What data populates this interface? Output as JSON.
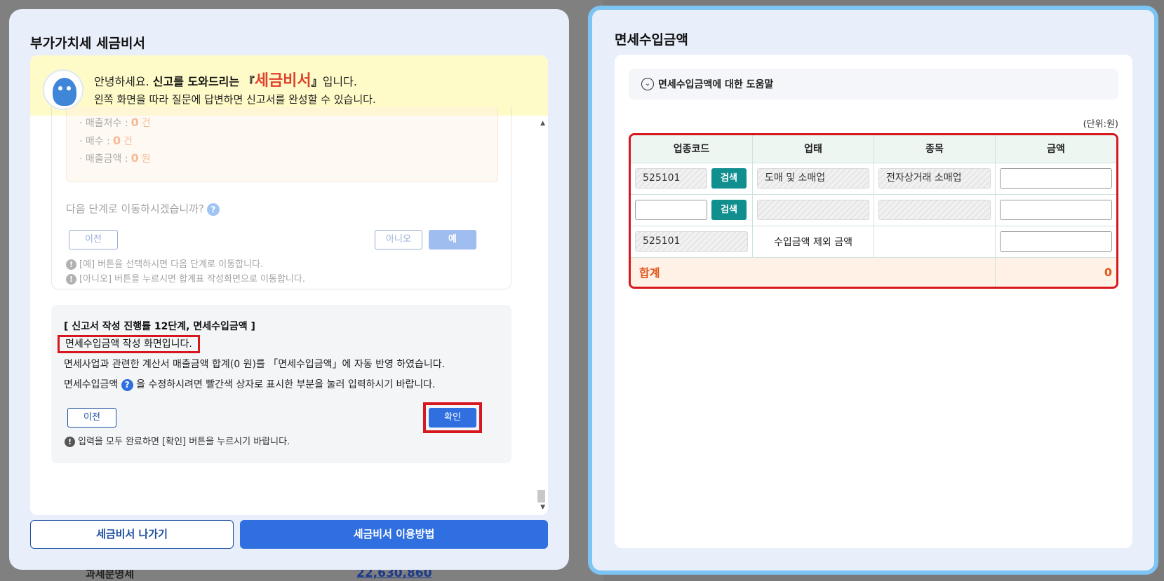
{
  "background": {
    "tax_label": "과세분명세",
    "tax_amount": "22,630,860"
  },
  "left_modal": {
    "title": "부가가치세 세금비서",
    "greeting": {
      "line1_prefix": "안녕하세요. ",
      "line1_bold": "신고를 도와드리는 ",
      "brand_open": "『",
      "brand": "세금비서",
      "brand_close": "』",
      "line1_suffix": "입니다.",
      "line2": "왼쪽 화면을 따라 질문에 답변하면 신고서를 완성할 수 있습니다."
    },
    "summary": {
      "items": [
        {
          "label": "매출처수 :",
          "value": "0",
          "unit": "건"
        },
        {
          "label": "매수 :",
          "value": "0",
          "unit": "건"
        },
        {
          "label": "매출금액 :",
          "value": "0",
          "unit": "원"
        }
      ]
    },
    "next_question": "다음 단계로 이동하시겠습니까?",
    "prev_label": "이전",
    "no_label": "아니오",
    "yes_label": "예",
    "notes": [
      "[예] 버튼을 선택하시면 다음 단계로 이동합니다.",
      "[아니오] 버튼을 누르시면 합계표 작성화면으로 이동합니다."
    ],
    "progress": {
      "title": "[ 신고서 작성 진행률 12단계, 면세수입금액 ]",
      "highlight": "면세수입금액 작성 화면입니다.",
      "line1": "면세사업과 관련한 계산서 매출금액 합계(0 원)를 「면세수입금액」에 자동 반영 하였습니다.",
      "line2_prefix": "면세수입금액 ",
      "line2_suffix": " 을 수정하시려면 빨간색 상자로 표시한 부분을 눌러 입력하시기 바랍니다.",
      "prev_label": "이전",
      "confirm_label": "확인",
      "note": "입력을 모두 완료하면 [확인] 버튼을 누르시기 바랍니다."
    },
    "exit_label": "세금비서 나가기",
    "guide_label": "세금비서 이용방법"
  },
  "right_modal": {
    "title": "면세수입금액",
    "help_text": "면세수입금액에 대한 도움말",
    "unit": "(단위:원)",
    "table": {
      "headers": [
        "업종코드",
        "업태",
        "종목",
        "금액"
      ],
      "search_label": "검색",
      "rows": [
        {
          "code": "525101",
          "business_type": "도매 및 소매업",
          "item": "전자상거래 소매업",
          "amount": ""
        },
        {
          "code": "",
          "business_type": "",
          "item": "",
          "amount": ""
        },
        {
          "code": "525101",
          "business_type": "수입금액 제외 금액",
          "item": "",
          "amount": ""
        }
      ],
      "total_label": "합계",
      "total_value": "0"
    }
  },
  "colors": {
    "accent_blue": "#2f6fe0",
    "highlight_red": "#d6171e",
    "search_teal": "#118f8f",
    "total_orange": "#e0561a"
  }
}
